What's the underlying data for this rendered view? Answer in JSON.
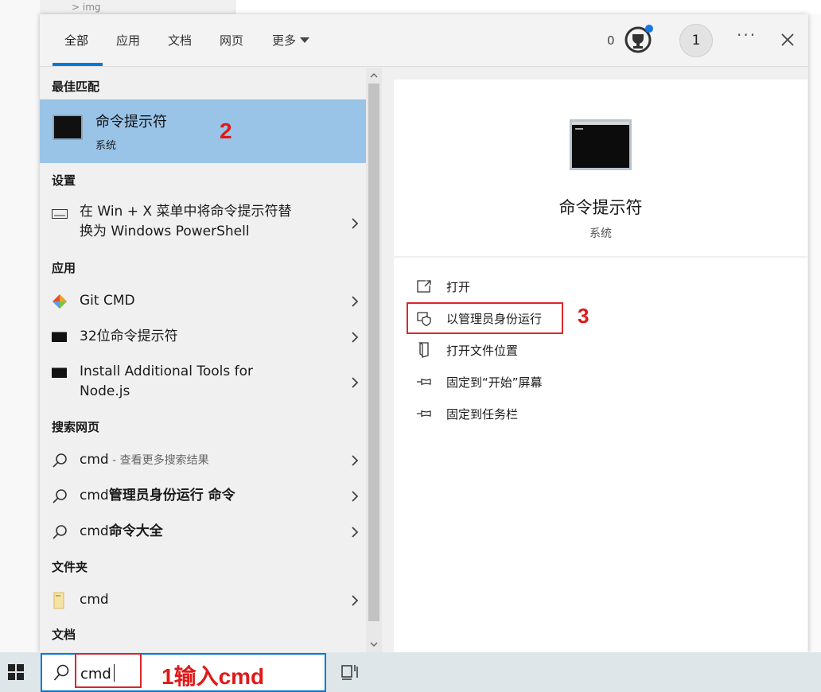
{
  "background": {
    "breadcrumb_fragment": "> img"
  },
  "tabs": [
    {
      "label": "全部",
      "active": true
    },
    {
      "label": "应用",
      "active": false
    },
    {
      "label": "文档",
      "active": false
    },
    {
      "label": "网页",
      "active": false
    },
    {
      "label": "更多",
      "active": false
    }
  ],
  "header": {
    "points": "0",
    "avatar_initial": "1"
  },
  "sections": {
    "best_match": "最佳匹配",
    "settings": "设置",
    "apps": "应用",
    "web": "搜索网页",
    "folders": "文件夹",
    "documents": "文档"
  },
  "best_match": {
    "title": "命令提示符",
    "subtitle": "系统"
  },
  "settings_items": [
    {
      "line1": "在 Win + X 菜单中将命令提示符替",
      "line2": "换为 Windows PowerShell"
    }
  ],
  "app_items": [
    {
      "label": "Git CMD"
    },
    {
      "label": "32位命令提示符"
    },
    {
      "line1": "Install Additional Tools for",
      "line2": "Node.js"
    }
  ],
  "web_items": [
    {
      "query": "cmd",
      "hint": " - 查看更多搜索结果"
    },
    {
      "query": "cmd",
      "bold": "管理员身份运行 命令"
    },
    {
      "query": "cmd",
      "bold": "命令大全"
    }
  ],
  "folder_items": [
    {
      "label": "cmd"
    }
  ],
  "detail": {
    "title": "命令提示符",
    "subtitle": "系统",
    "actions": [
      {
        "label": "打开",
        "icon": "open-icon"
      },
      {
        "label": "以管理员身份运行",
        "icon": "shield-icon"
      },
      {
        "label": "打开文件位置",
        "icon": "file-location-icon"
      },
      {
        "label": "固定到“开始”屏幕",
        "icon": "pin-icon"
      },
      {
        "label": "固定到任务栏",
        "icon": "pin-icon"
      }
    ]
  },
  "search": {
    "value": "cmd"
  },
  "annotations": {
    "step1": "1输入cmd",
    "step2": "2",
    "step3": "3"
  },
  "colors": {
    "accent": "#0078d7",
    "selection": "#99c4e8",
    "annotation_red": "#e01919"
  }
}
